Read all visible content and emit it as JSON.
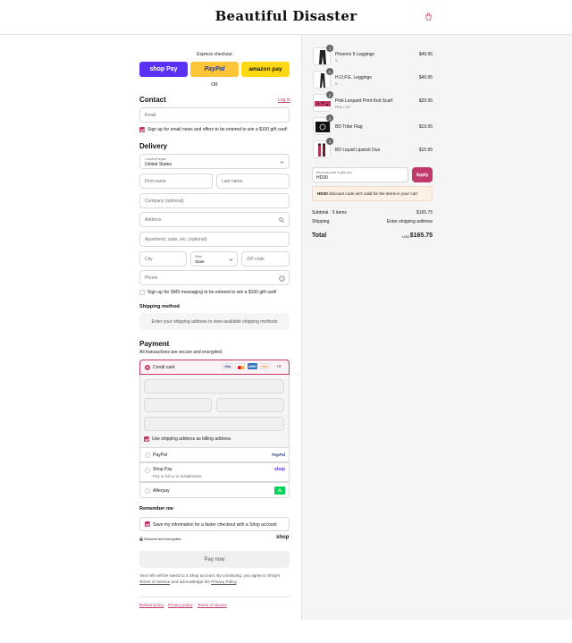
{
  "header": {
    "logo": "Beautiful Disaster",
    "bag_icon": "shopping-bag-icon",
    "accent": "#c1386b"
  },
  "express": {
    "label": "Express checkout",
    "buttons": [
      {
        "label": "shop Pay",
        "bg": "#5a31f4",
        "color": "#ffffff"
      },
      {
        "label": "PayPal",
        "bg": "#ffc439",
        "color": "#253b80"
      },
      {
        "label": "amazon pay",
        "bg": "#ffd814",
        "color": "#111111"
      }
    ],
    "or": "OR"
  },
  "contact": {
    "title": "Contact",
    "login": "Log in",
    "email_placeholder": "Email",
    "newsletter": "Sign up for email news and offers to be entered to win a $100 gift card!"
  },
  "delivery": {
    "title": "Delivery",
    "country_label": "Country/Region",
    "country_value": "United States",
    "first_name": "First name",
    "last_name": "Last name",
    "company": "Company (optional)",
    "address": "Address",
    "apartment": "Apartment, suite, etc. (optional)",
    "city": "City",
    "state_label": "State",
    "state_value": "State",
    "zip": "ZIP code",
    "phone": "Phone",
    "sms": "Sign up for SMS messaging to be entered to win a $100 gift card!"
  },
  "shipping_method": {
    "title": "Shipping method",
    "note": "Enter your shipping address to view available shipping methods"
  },
  "payment": {
    "title": "Payment",
    "subtitle": "All transactions are secure and encrypted.",
    "credit_card": "Credit card",
    "card_brands": [
      "VISA",
      "MC",
      "AMEX",
      "DISC"
    ],
    "more_cards": "+3",
    "billing": "Use shipping address as billing address",
    "paypal": "PayPal",
    "paypal_logo": "PayPal",
    "shop_pay": "Shop Pay",
    "shop_pay_sub": "Pay in full or in installments",
    "shop_logo": "shop",
    "afterpay": "Afterpay",
    "afterpay_icon": "afterpay-icon"
  },
  "remember": {
    "title": "Remember me",
    "save": "Save my information for a faster checkout with a Shop account",
    "secure": "Secured and encrypted",
    "shop_logo": "shop"
  },
  "pay_now": "Pay now",
  "legal": {
    "text1": "Your info will be saved to a Shop account. By continuing, you agree to Shop's",
    "terms": "Terms of Service",
    "and": "and acknowledge the",
    "privacy": "Privacy Policy",
    "period": "."
  },
  "footer": {
    "refund": "Refund policy",
    "privacy": "Privacy policy",
    "terms": "Terms of service"
  },
  "cart": {
    "items": [
      {
        "name": "Phoenix II Leggings",
        "variant": "S",
        "price": "$49.95",
        "qty": "1"
      },
      {
        "name": "H.O.P.E. Leggings",
        "variant": "S",
        "price": "$49.95",
        "qty": "1"
      },
      {
        "name": "Pink Leopard Print Knit Scarf",
        "variant": "Pink / OS",
        "price": "$29.95",
        "qty": "1"
      },
      {
        "name": "BD Tribe Flag",
        "variant": "",
        "price": "$19.95",
        "qty": "1"
      },
      {
        "name": "BD Liquid Lipstick Duo",
        "variant": "",
        "price": "$15.95",
        "qty": "1"
      }
    ],
    "discount_label": "Discount code or gift card",
    "discount_value": "HD30",
    "apply": "Apply",
    "error_code": "HD30",
    "error_text": "discount code isn't valid for the items in your cart",
    "subtotal_label": "Subtotal · 5 items",
    "subtotal": "$165.75",
    "shipping_label": "Shipping",
    "shipping_value": "Enter shipping address",
    "total_label": "Total",
    "currency": "USD",
    "total": "$165.75"
  }
}
